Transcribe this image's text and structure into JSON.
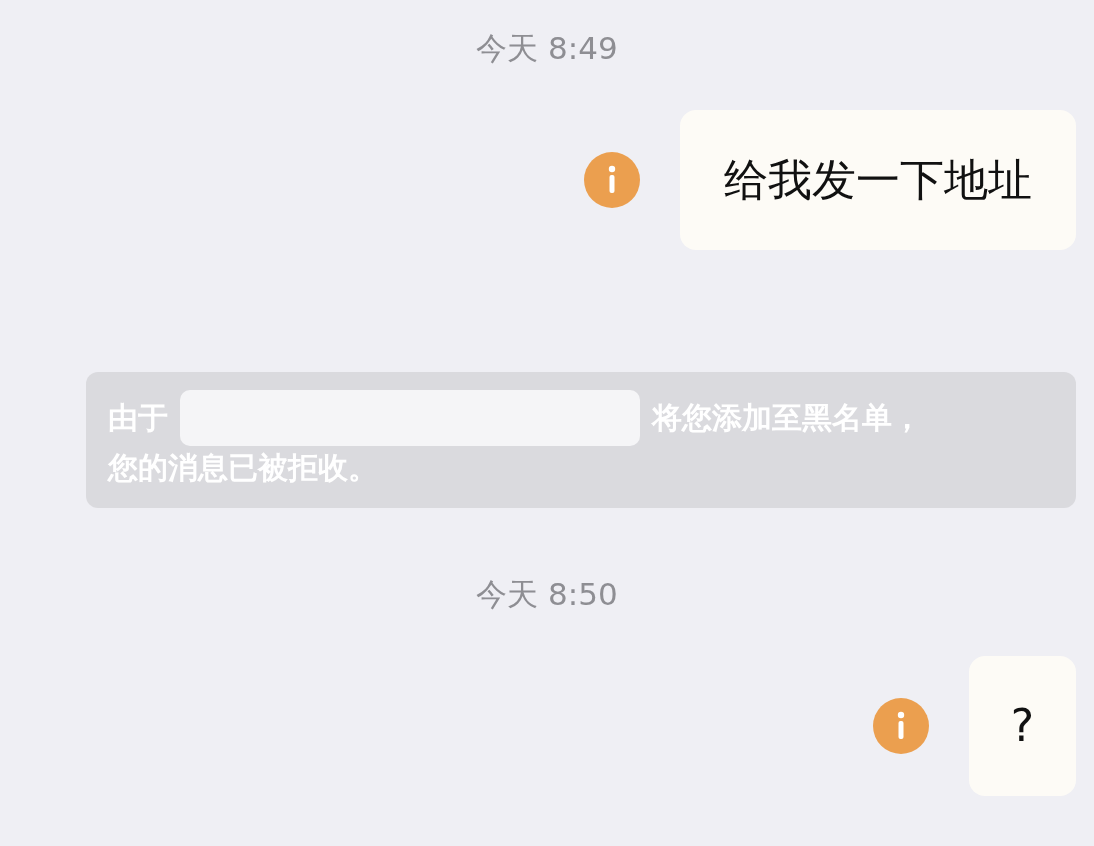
{
  "messages": [
    {
      "kind": "timestamp",
      "text": "今天 8:49"
    },
    {
      "kind": "outgoing",
      "text": "给我发一下地址",
      "failed": true
    },
    {
      "kind": "notice",
      "before": "由于",
      "redacted": true,
      "after": "将您添加至黑名单，",
      "second_line": "您的消息已被拒收。"
    },
    {
      "kind": "timestamp",
      "text": "今天 8:50"
    },
    {
      "kind": "outgoing",
      "text": "?",
      "failed": true
    }
  ]
}
